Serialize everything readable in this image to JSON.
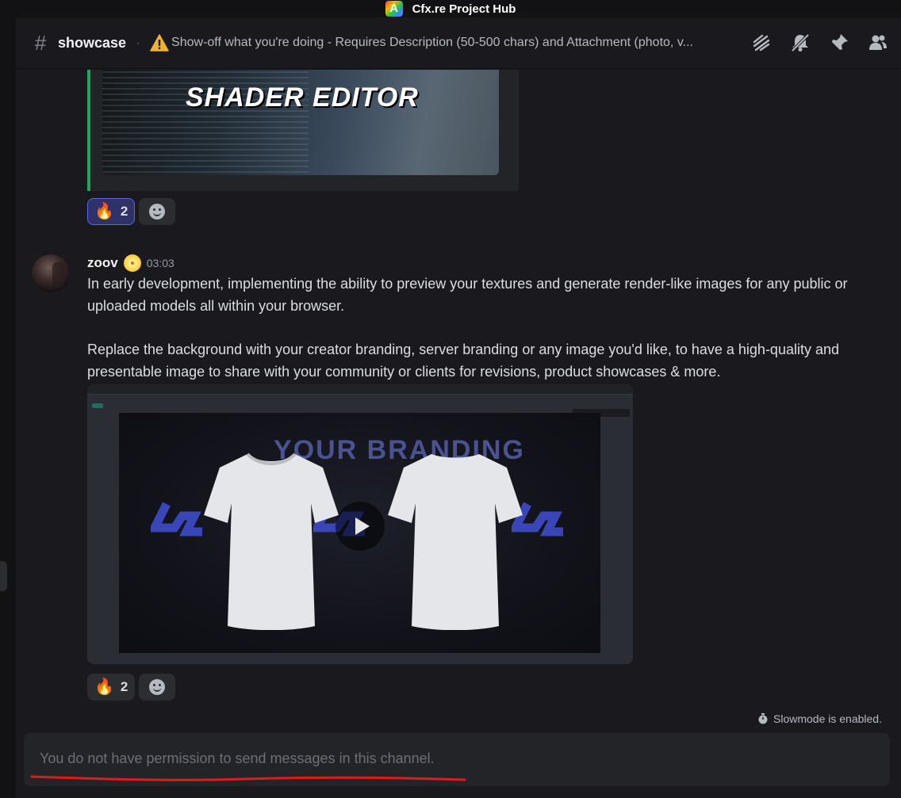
{
  "window": {
    "title": "Cfx.re Project Hub",
    "logo_letter": "A"
  },
  "header": {
    "channel_name": "showcase",
    "topic": "Show-off what you're doing - Requires Description (50-500 chars) and Attachment (photo, v...",
    "icons": [
      "threads-icon",
      "notifications-muted-icon",
      "pin-icon",
      "members-icon"
    ]
  },
  "embed": {
    "image_title": "SHADER EDITOR",
    "accent_color": "#23a55a"
  },
  "reactions_top": [
    {
      "emoji": "🔥",
      "count": "2",
      "me": true
    }
  ],
  "message": {
    "username": "zoov",
    "timestamp": "03:03",
    "paragraphs": [
      "In early development, implementing the ability to preview your textures and generate render-like images for any public or uploaded models all within your browser.",
      "Replace the background with your creator branding, server branding or any image you'd like, to have a high-quality and presentable image to share with your community or clients for revisions, product showcases & more."
    ],
    "video": {
      "overlay_text": "YOUR BRANDING"
    }
  },
  "reactions_bottom": [
    {
      "emoji": "🔥",
      "count": "2",
      "me": false
    }
  ],
  "slowmode": {
    "text": "Slowmode is enabled."
  },
  "composer": {
    "text": "You do not have permission to send messages in this channel."
  },
  "colors": {
    "accent": "#5865f2",
    "annotation_red": "#e01b1b"
  }
}
